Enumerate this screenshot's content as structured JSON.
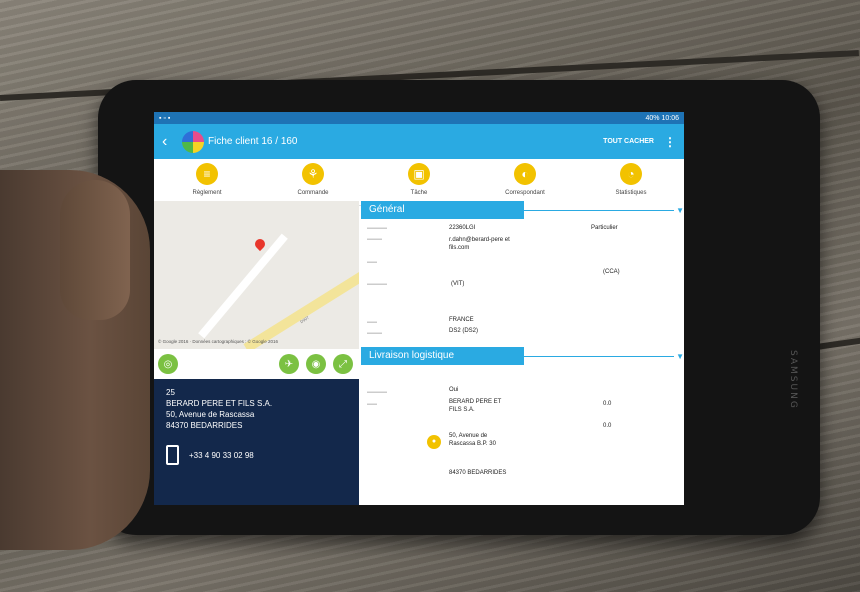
{
  "status_bar": {
    "right": "40% 10:06"
  },
  "app_bar": {
    "title": "Fiche client 16 / 160",
    "hide_all": "TOUT CACHER"
  },
  "actions": [
    {
      "label": "Règlement",
      "icon": "coins-icon"
    },
    {
      "label": "Commande",
      "icon": "cart-icon"
    },
    {
      "label": "Tâche",
      "icon": "clipboard-icon"
    },
    {
      "label": "Correspondant",
      "icon": "contact-icon"
    },
    {
      "label": "Statistiques",
      "icon": "chart-icon"
    }
  ],
  "map": {
    "road_label": "D907",
    "caption": "© Google 2016 · Données cartographiques : © Google 2016"
  },
  "address": {
    "code": "25",
    "company": "BERARD PERE ET FILS S.A.",
    "street": "50, Avenue de Rascassa",
    "city": "84370  BEDARRIDES",
    "phone": "+33 4 90 33 02 98"
  },
  "general": {
    "title": "Général",
    "client_code": "22360LGI",
    "email": "r.dahn@berard-pere et fils.com",
    "type": "Particulier",
    "tva": "(VIT)",
    "cca": "(CCA)",
    "country": "FRANCE",
    "region": "DS2 (DS2)"
  },
  "delivery": {
    "title": "Livraison logistique",
    "active": "Oui",
    "name": "BERARD PERE ET FILS S.A.",
    "address": "50, Avenue de Rascassa B.P. 30",
    "postal": "84370 BEDARRIDES",
    "coord1": "0.0",
    "coord2": "0.0"
  },
  "device_brand": "SAMSUNG",
  "colors": {
    "appbar": "#2aaae2",
    "accent_yellow": "#f2c200",
    "map_tools": "#7bc142",
    "address_bg": "#13284b"
  }
}
